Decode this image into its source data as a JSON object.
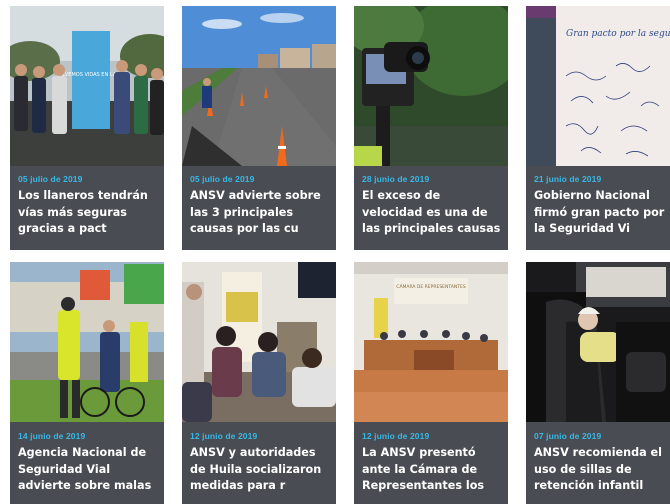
{
  "news": [
    {
      "date": "05 julio de 2019",
      "title": "Los llaneros tendrán vías más seguras gracias a pact",
      "image": "group-with-banner-photo"
    },
    {
      "date": "05 julio de 2019",
      "title": "ANSV advierte sobre las 3 principales causas por las cu",
      "image": "road-with-cones-photo"
    },
    {
      "date": "28 junio de 2019",
      "title": "El exceso de velocidad es una de las principales causas",
      "image": "speed-camera-photo"
    },
    {
      "date": "21 junio de 2019",
      "title": "Gobierno Nacional firmó gran pacto por la Seguridad Vi",
      "image": "signed-pact-banner-photo"
    },
    {
      "date": "14 junio de 2019",
      "title": "Agencia Nacional de Seguridad Vial advierte sobre malas",
      "image": "cyclists-and-police-photo"
    },
    {
      "date": "12 junio de 2019",
      "title": "ANSV y autoridades de Huila socializaron medidas para r",
      "image": "meeting-room-photo"
    },
    {
      "date": "12 junio de 2019",
      "title": "La ANSV presentó ante la Cámara de Representantes los",
      "image": "congress-chamber-photo"
    },
    {
      "date": "07 junio de 2019",
      "title": "ANSV recomienda el uso de sillas de retención infantil",
      "image": "child-car-seat-photo"
    }
  ],
  "banner_text": {
    "road_safety_banner": "SALVEMOS VIDAS EN LA VÍA",
    "pact_banner": "Gran pacto por la seguridad vial en Colombia",
    "chamber_sign": "CÁMARA DE REPRESENTANTES"
  },
  "colors": {
    "card_bg": "#4a4c53",
    "date_accent": "#35b9e6",
    "title_text": "#ffffff"
  }
}
